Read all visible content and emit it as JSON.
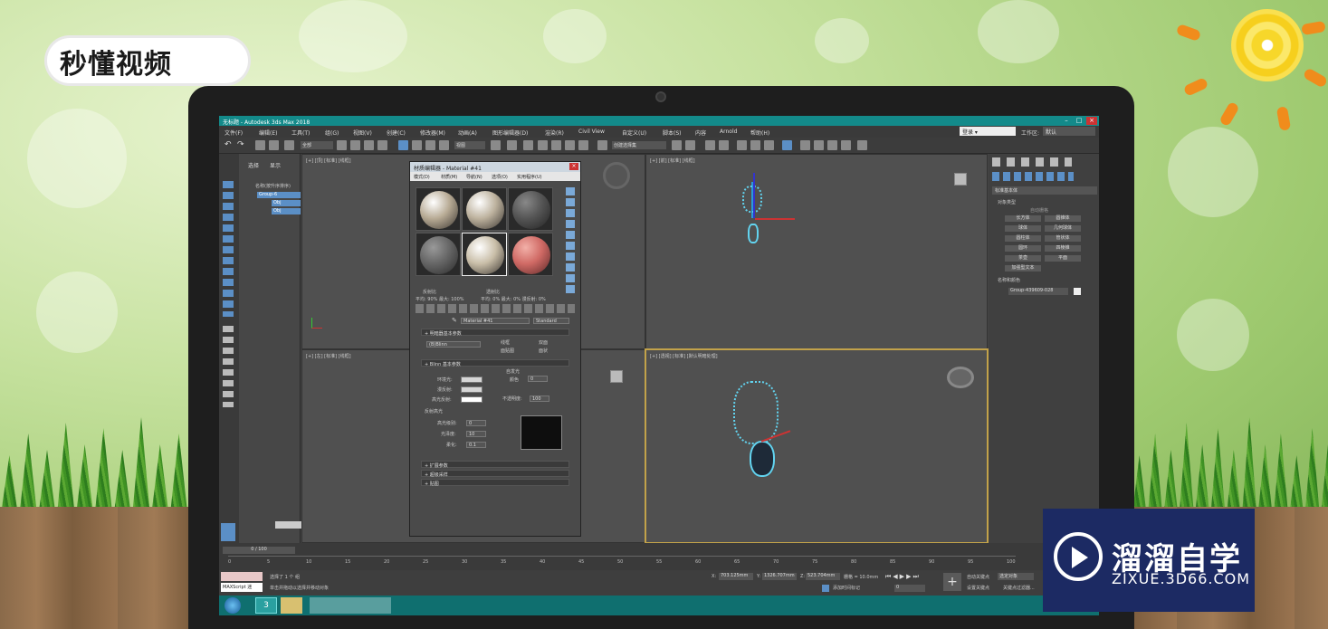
{
  "watermark_top": "秒懂视频",
  "watermark_bottom": {
    "title": "溜溜自学",
    "url": "ZIXUE.3D66.COM"
  },
  "window": {
    "title": "无标题 - Autodesk 3ds Max 2018",
    "workspace_label": "工作区:",
    "workspace_value": "默认",
    "login": "登录"
  },
  "menu": [
    "文件(F)",
    "编辑(E)",
    "工具(T)",
    "组(G)",
    "视图(V)",
    "创建(C)",
    "修改器(M)",
    "动画(A)",
    "图形编辑器(D)",
    "渲染(R)",
    "Civil View",
    "自定义(U)",
    "脚本(S)",
    "内容",
    "Arnold",
    "帮助(H)"
  ],
  "toolbar": {
    "select_filter": "全部",
    "view_dropdown": "视图",
    "named_set": "创建选择集"
  },
  "scene_panel": {
    "tabs": [
      "选择",
      "显示"
    ],
    "header": "名称(按升序排序)",
    "items": [
      "Group-6",
      "Obj",
      "Obj"
    ]
  },
  "viewports": {
    "top": "[+] [顶] [标准] [线框]",
    "front": "[+] [前] [标准] [线框]",
    "left": "[+] [左] [标准] [线框]",
    "perspective": "[+] [透视] [标准] [默认明暗处理]"
  },
  "material_editor": {
    "title": "材质编辑器 - Material #41",
    "menu": [
      "模式(D)",
      "材质(M)",
      "导航(N)",
      "选项(O)",
      "实用程序(U)"
    ],
    "reflect": "反射比",
    "reflect_vals": "平均: 90% 最大: 100%",
    "trans": "透射比",
    "trans_vals": "平均: 0% 最大: 0% 漫反射: 0%",
    "material_name": "Material #41",
    "material_type": "Standard",
    "rollout_shader": "明暗器基本参数",
    "shader_type": "(B)Blinn",
    "options": [
      "线框",
      "双面",
      "面贴图",
      "面状"
    ],
    "rollout_blinn": "Blinn 基本参数",
    "self_illum": "自发光",
    "color_label": "颜色",
    "color_val": "0",
    "ambient": "环境光:",
    "diffuse": "漫反射:",
    "specular": "高光反射:",
    "opacity": "不透明度:",
    "opacity_val": "100",
    "spec_highlights": "反射高光",
    "spec_level": "高光级别:",
    "spec_level_val": "0",
    "gloss": "光泽度:",
    "gloss_val": "10",
    "soften": "柔化:",
    "soften_val": "0.1",
    "rollouts_bottom": [
      "扩展参数",
      "超级采样",
      "贴图"
    ]
  },
  "right_panel": {
    "dropdown": "标准基本体",
    "section_type": "对象类型",
    "autogrid": "自动栅格",
    "buttons": [
      "长方体",
      "圆锥体",
      "球体",
      "几何球体",
      "圆柱体",
      "管状体",
      "圆环",
      "四棱锥",
      "茶壶",
      "平面",
      "加强型文本"
    ],
    "section_name": "名称和颜色",
    "name_value": "Group-439609-028"
  },
  "timeline": {
    "frame": "0 / 100",
    "ticks": [
      "0",
      "5",
      "10",
      "15",
      "20",
      "25",
      "30",
      "35",
      "40",
      "45",
      "50",
      "55",
      "60",
      "65",
      "70",
      "75",
      "80",
      "85",
      "90",
      "95",
      "100"
    ]
  },
  "status": {
    "maxscript": "MAXScript 迷",
    "selected": "选择了 1 个 组",
    "hint": "单击并拖动以选择并移动对象",
    "x": "703.125mm",
    "y": "1326.707mm",
    "z": "523.704mm",
    "grid": "栅格 = 10.0mm",
    "add_time_tag": "添加时间标记",
    "auto_key": "自动关键点",
    "set_key": "设置关键点",
    "selected_obj": "选定对象",
    "key_filters": "关键点过滤器...",
    "frame_field": "0"
  },
  "colors": {
    "title_bar": "#138a8a",
    "viewport_bg": "#505050",
    "active_viewport_border": "#c2a24a",
    "watermark_bg": "#1c2a63",
    "object_highlight": "#29c9e6"
  }
}
